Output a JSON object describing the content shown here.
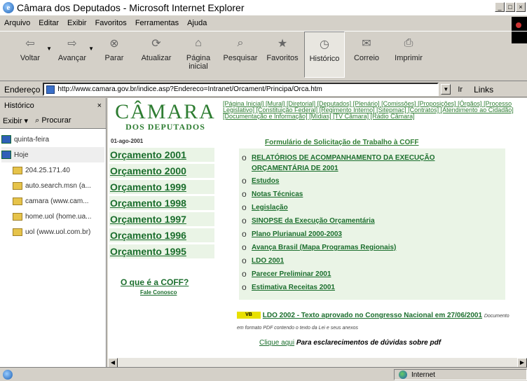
{
  "window": {
    "title": "Câmara dos Deputados - Microsoft Internet Explorer",
    "controls": [
      "_",
      "□",
      "×"
    ]
  },
  "menu": [
    "Arquivo",
    "Editar",
    "Exibir",
    "Favoritos",
    "Ferramentas",
    "Ajuda"
  ],
  "toolbar": [
    {
      "label": "Voltar",
      "icon": "back-arrow-icon",
      "glyph": "⇦"
    },
    {
      "label": "Avançar",
      "icon": "forward-arrow-icon",
      "glyph": "⇨"
    },
    {
      "label": "Parar",
      "icon": "stop-icon",
      "glyph": "⊗"
    },
    {
      "label": "Atualizar",
      "icon": "refresh-icon",
      "glyph": "⟳"
    },
    {
      "label": "Página inicial",
      "icon": "home-icon",
      "glyph": "⌂"
    },
    {
      "label": "Pesquisar",
      "icon": "search-icon",
      "glyph": "⌕"
    },
    {
      "label": "Favoritos",
      "icon": "favorites-icon",
      "glyph": "★"
    },
    {
      "label": "Histórico",
      "icon": "history-icon",
      "glyph": "◷"
    },
    {
      "label": "Correio",
      "icon": "mail-icon",
      "glyph": "✉"
    },
    {
      "label": "Imprimir",
      "icon": "print-icon",
      "glyph": "⎙"
    }
  ],
  "address": {
    "label": "Endereço",
    "url": "http://www.camara.gov.br/indice.asp?Endereco=Intranet/Orcament/Principa/Orca.htm",
    "go": "Ir",
    "links": "Links"
  },
  "history": {
    "title": "Histórico",
    "close": "×",
    "view": "Exibir ▾",
    "search": "Procurar",
    "items": [
      {
        "label": "quinta-feira",
        "type": "day"
      },
      {
        "label": "Hoje",
        "type": "day"
      },
      {
        "label": "204.25.171.40",
        "type": "site"
      },
      {
        "label": "auto.search.msn (a...",
        "type": "site"
      },
      {
        "label": "camara (www.cam...",
        "type": "site"
      },
      {
        "label": "home.uol (home.ua...",
        "type": "site"
      },
      {
        "label": "uol (www.uol.com.br)",
        "type": "site"
      }
    ]
  },
  "page": {
    "logo_line1": "CÂMARA",
    "logo_line2": "DOS DEPUTADOS",
    "top_links": "[Página Inicial] [Mural] [Diretorial] [Deputados] [Plenário] [Comissões] [Proposições] [Órgãos] [Processo Legislativo] [Constituição Federal] [Regimento Interno] [Sitepmac] [Contratos] [Atendimento ao Cidadão] [Documentação e Informação] [Mídias] [TV Câmara] [Rádio Câmara]",
    "date": "01-ago-2001",
    "orcamentos": [
      "Orçamento 2001",
      "Orçamento 2000",
      "Orçamento 1999",
      "Orçamento 1998",
      "Orçamento 1997",
      "Orçamento 1996",
      "Orçamento 1995"
    ],
    "coff_question": "O que é a COFF?",
    "fale_conosco": "Fale Conosco",
    "form_link": "Formulário de Solicitação de Trabalho à COFF",
    "links": [
      "RELATÓRIOS DE ACOMPANHAMENTO DA EXECUÇÃO",
      "ORÇAMENTÁRIA DE 2001",
      "Estudos",
      "Notas Técnicas",
      "Legislação",
      "SINOPSE da Execução Orçamentária",
      "Plano Plurianual 2000-2003",
      "Avança Brasil (Mapa Programas Regionais)",
      "LDO 2001",
      "Parecer Preliminar 2001",
      "Estimativa Receitas 2001"
    ],
    "new_badge": "VB",
    "ldo2002": "LDO 2002 - Texto aprovado no Congresso Nacional em 27/06/2001",
    "ldo_note": "Documento em formato PDF contendo o texto da Lei e seus anexos",
    "clique_link": "Clique aqui",
    "clique_text": "Para esclarecimentos de dúvidas sobre pdf"
  },
  "status": {
    "zone": "Internet"
  }
}
